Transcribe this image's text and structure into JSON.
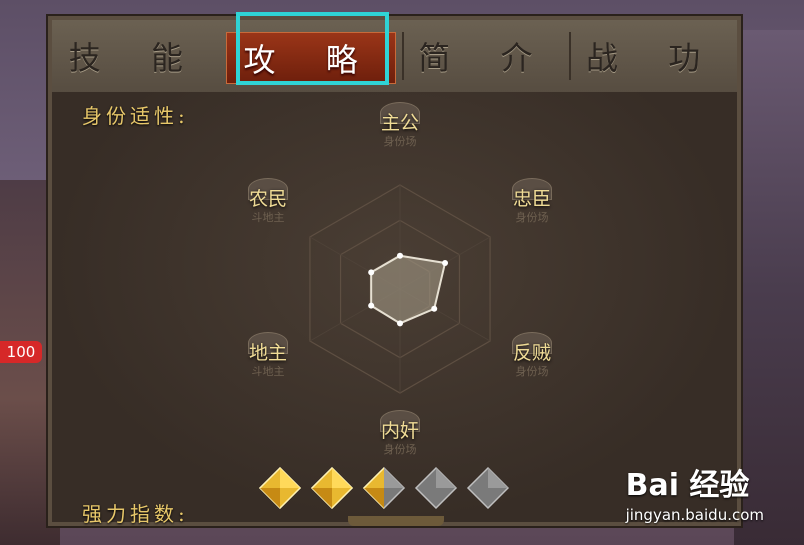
{
  "tabs": [
    {
      "label": "技 能",
      "active": false
    },
    {
      "label": "攻 略",
      "active": true
    },
    {
      "label": "简 介",
      "active": false
    },
    {
      "label": "战 功",
      "active": false
    }
  ],
  "badge": "100",
  "identity_label": "身份适性:",
  "strength_label": "强力指数:",
  "roles": {
    "lord": {
      "title": "主公",
      "sub": "身份场"
    },
    "loyalist": {
      "title": "忠臣",
      "sub": "身份场"
    },
    "rebel": {
      "title": "反贼",
      "sub": "身份场"
    },
    "spy": {
      "title": "内奸",
      "sub": "身份场"
    },
    "landlord": {
      "title": "地主",
      "sub": "斗地主"
    },
    "peasant": {
      "title": "农民",
      "sub": "斗地主"
    }
  },
  "chart_data": {
    "type": "radar",
    "axes": [
      "主公",
      "忠臣",
      "反贼",
      "内奸",
      "地主",
      "农民"
    ],
    "values": [
      0.32,
      0.5,
      0.38,
      0.33,
      0.32,
      0.32
    ],
    "max": 1.0
  },
  "strength": {
    "value": 2.5,
    "max": 5
  },
  "watermark": {
    "brand": "Bai 经验",
    "url": "jingyan.baidu.com"
  },
  "colors": {
    "accent": "#2fd4d6",
    "gold": "#e8b830",
    "active_tab": "#8b2a12"
  }
}
